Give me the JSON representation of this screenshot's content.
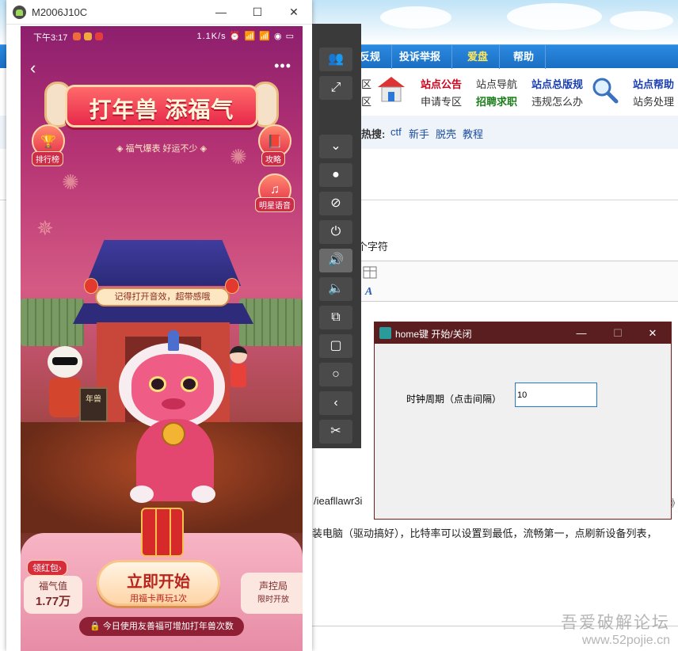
{
  "forum": {
    "nav_items": [
      "反规",
      "投诉举报",
      "爱盘",
      "帮助"
    ],
    "quick_links": {
      "col1": [
        "区",
        "区"
      ],
      "col2": [
        "站点公告",
        "申请专区"
      ],
      "col3": [
        "站点导航",
        "招聘求职"
      ],
      "col4": [
        "站点总版规",
        "违规怎么办"
      ],
      "col5": [
        "站点帮助",
        "站务处理"
      ]
    },
    "hot_label": "热搜:",
    "hot_tags": [
      "ctf",
      "新手",
      "脱壳",
      "教程"
    ],
    "chars_text": "个字符",
    "url_text": "/ieafllawr3i",
    "body_line": "装电脑（驱动搞好），比特率可以设置到最低，流畅第一，点刷新设备列表，",
    "watermark": [
      "吾爱破解论坛",
      "www.52pojie.cn"
    ],
    "bracket": "》"
  },
  "phone_window": {
    "title": "M2006J10C",
    "controls": [
      "—",
      "☐",
      "✕"
    ]
  },
  "status_bar": {
    "time": "下午3:17",
    "right": "1.1K/s ⏰ 📶 📶 ◉ ▭"
  },
  "game": {
    "banner_title": "打年兽 添福气",
    "slogan": "◈ 福气爆表 好运不少 ◈",
    "rank_label": "排行榜",
    "guide_label": "攻略",
    "voice_label": "明星语音",
    "sound_tip": "记得打开音效，超带感哦",
    "sign_text": "年兽",
    "redpack_badge": "领红包›",
    "luck_label": "福气值",
    "luck_value": "1.77万",
    "start_label": "立即开始",
    "start_sub": "用福卡再玩1次",
    "right_label": "声控局",
    "right_sub": "限时开放",
    "hint": "🔒 今日使用友善福可增加打年兽次数",
    "back_glyph": "‹",
    "more_glyph": "•••"
  },
  "toolbar": {
    "buttons": [
      {
        "glyph": "👥",
        "name": "users-icon"
      },
      {
        "glyph": "⤢",
        "name": "fullscreen-icon"
      },
      {
        "glyph": "⌄",
        "name": "collapse-icon"
      },
      {
        "glyph": "●",
        "name": "record-icon"
      },
      {
        "glyph": "⊘",
        "name": "hide-icon"
      },
      {
        "glyph": "⏻",
        "name": "power-icon"
      },
      {
        "glyph": "🔊",
        "name": "volume-up-icon"
      },
      {
        "glyph": "🔈",
        "name": "volume-down-icon"
      },
      {
        "glyph": "⧉",
        "name": "rotate-icon"
      },
      {
        "glyph": "▢",
        "name": "recents-icon"
      },
      {
        "glyph": "○",
        "name": "home-icon"
      },
      {
        "glyph": "‹",
        "name": "back-icon"
      },
      {
        "glyph": "✂",
        "name": "screenshot-icon"
      }
    ]
  },
  "dialog": {
    "title": "home键 开始/关闭",
    "label": "时钟周期（点击间隔）",
    "input_value": "10",
    "controls": [
      "—",
      "☐",
      "✕"
    ]
  }
}
